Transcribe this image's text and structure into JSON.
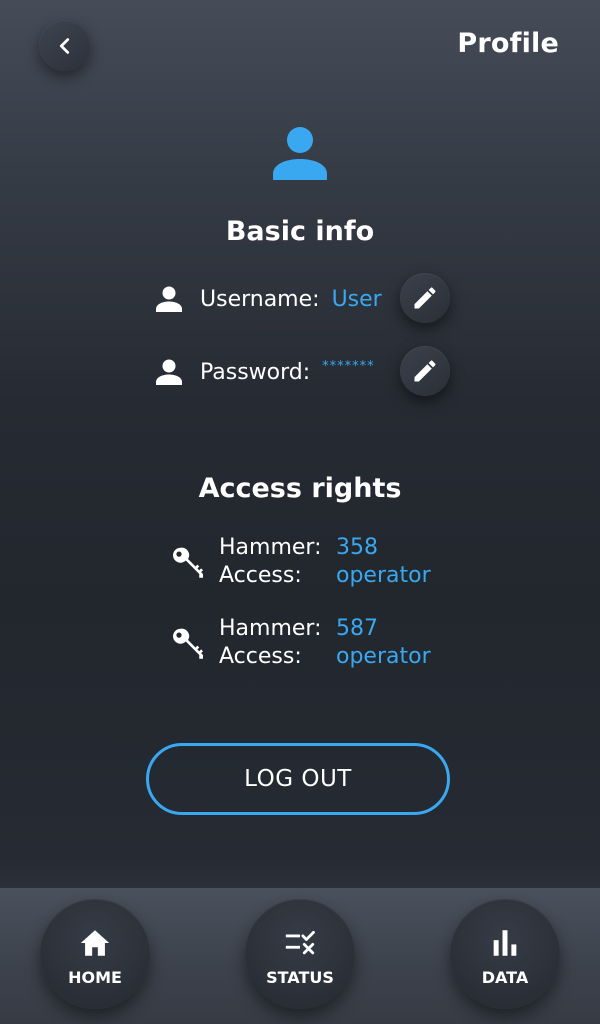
{
  "header": {
    "title": "Profile",
    "back_icon": "chevron-left-icon"
  },
  "avatar": {
    "icon": "person-icon",
    "color": "#39a8f0"
  },
  "basic_info": {
    "title": "Basic info",
    "username_label": "Username:",
    "username_value": "User",
    "password_label": "Password:",
    "password_value": "*******",
    "edit_icon": "pencil-icon"
  },
  "access_rights": {
    "title": "Access rights",
    "items": [
      {
        "hammer_label": "Hammer:",
        "hammer_value": "358",
        "access_label": "Access:",
        "access_value": "operator"
      },
      {
        "hammer_label": "Hammer:",
        "hammer_value": "587",
        "access_label": "Access:",
        "access_value": "operator"
      }
    ],
    "key_icon": "key-icon"
  },
  "logout": {
    "label": "LOG OUT",
    "border_color": "#39a8f0"
  },
  "nav": {
    "items": [
      {
        "label": "HOME",
        "icon": "home-icon"
      },
      {
        "label": "STATUS",
        "icon": "status-checklist-icon"
      },
      {
        "label": "DATA",
        "icon": "bar-chart-icon"
      }
    ]
  },
  "colors": {
    "accent": "#39a8f0",
    "text": "#ffffff"
  }
}
